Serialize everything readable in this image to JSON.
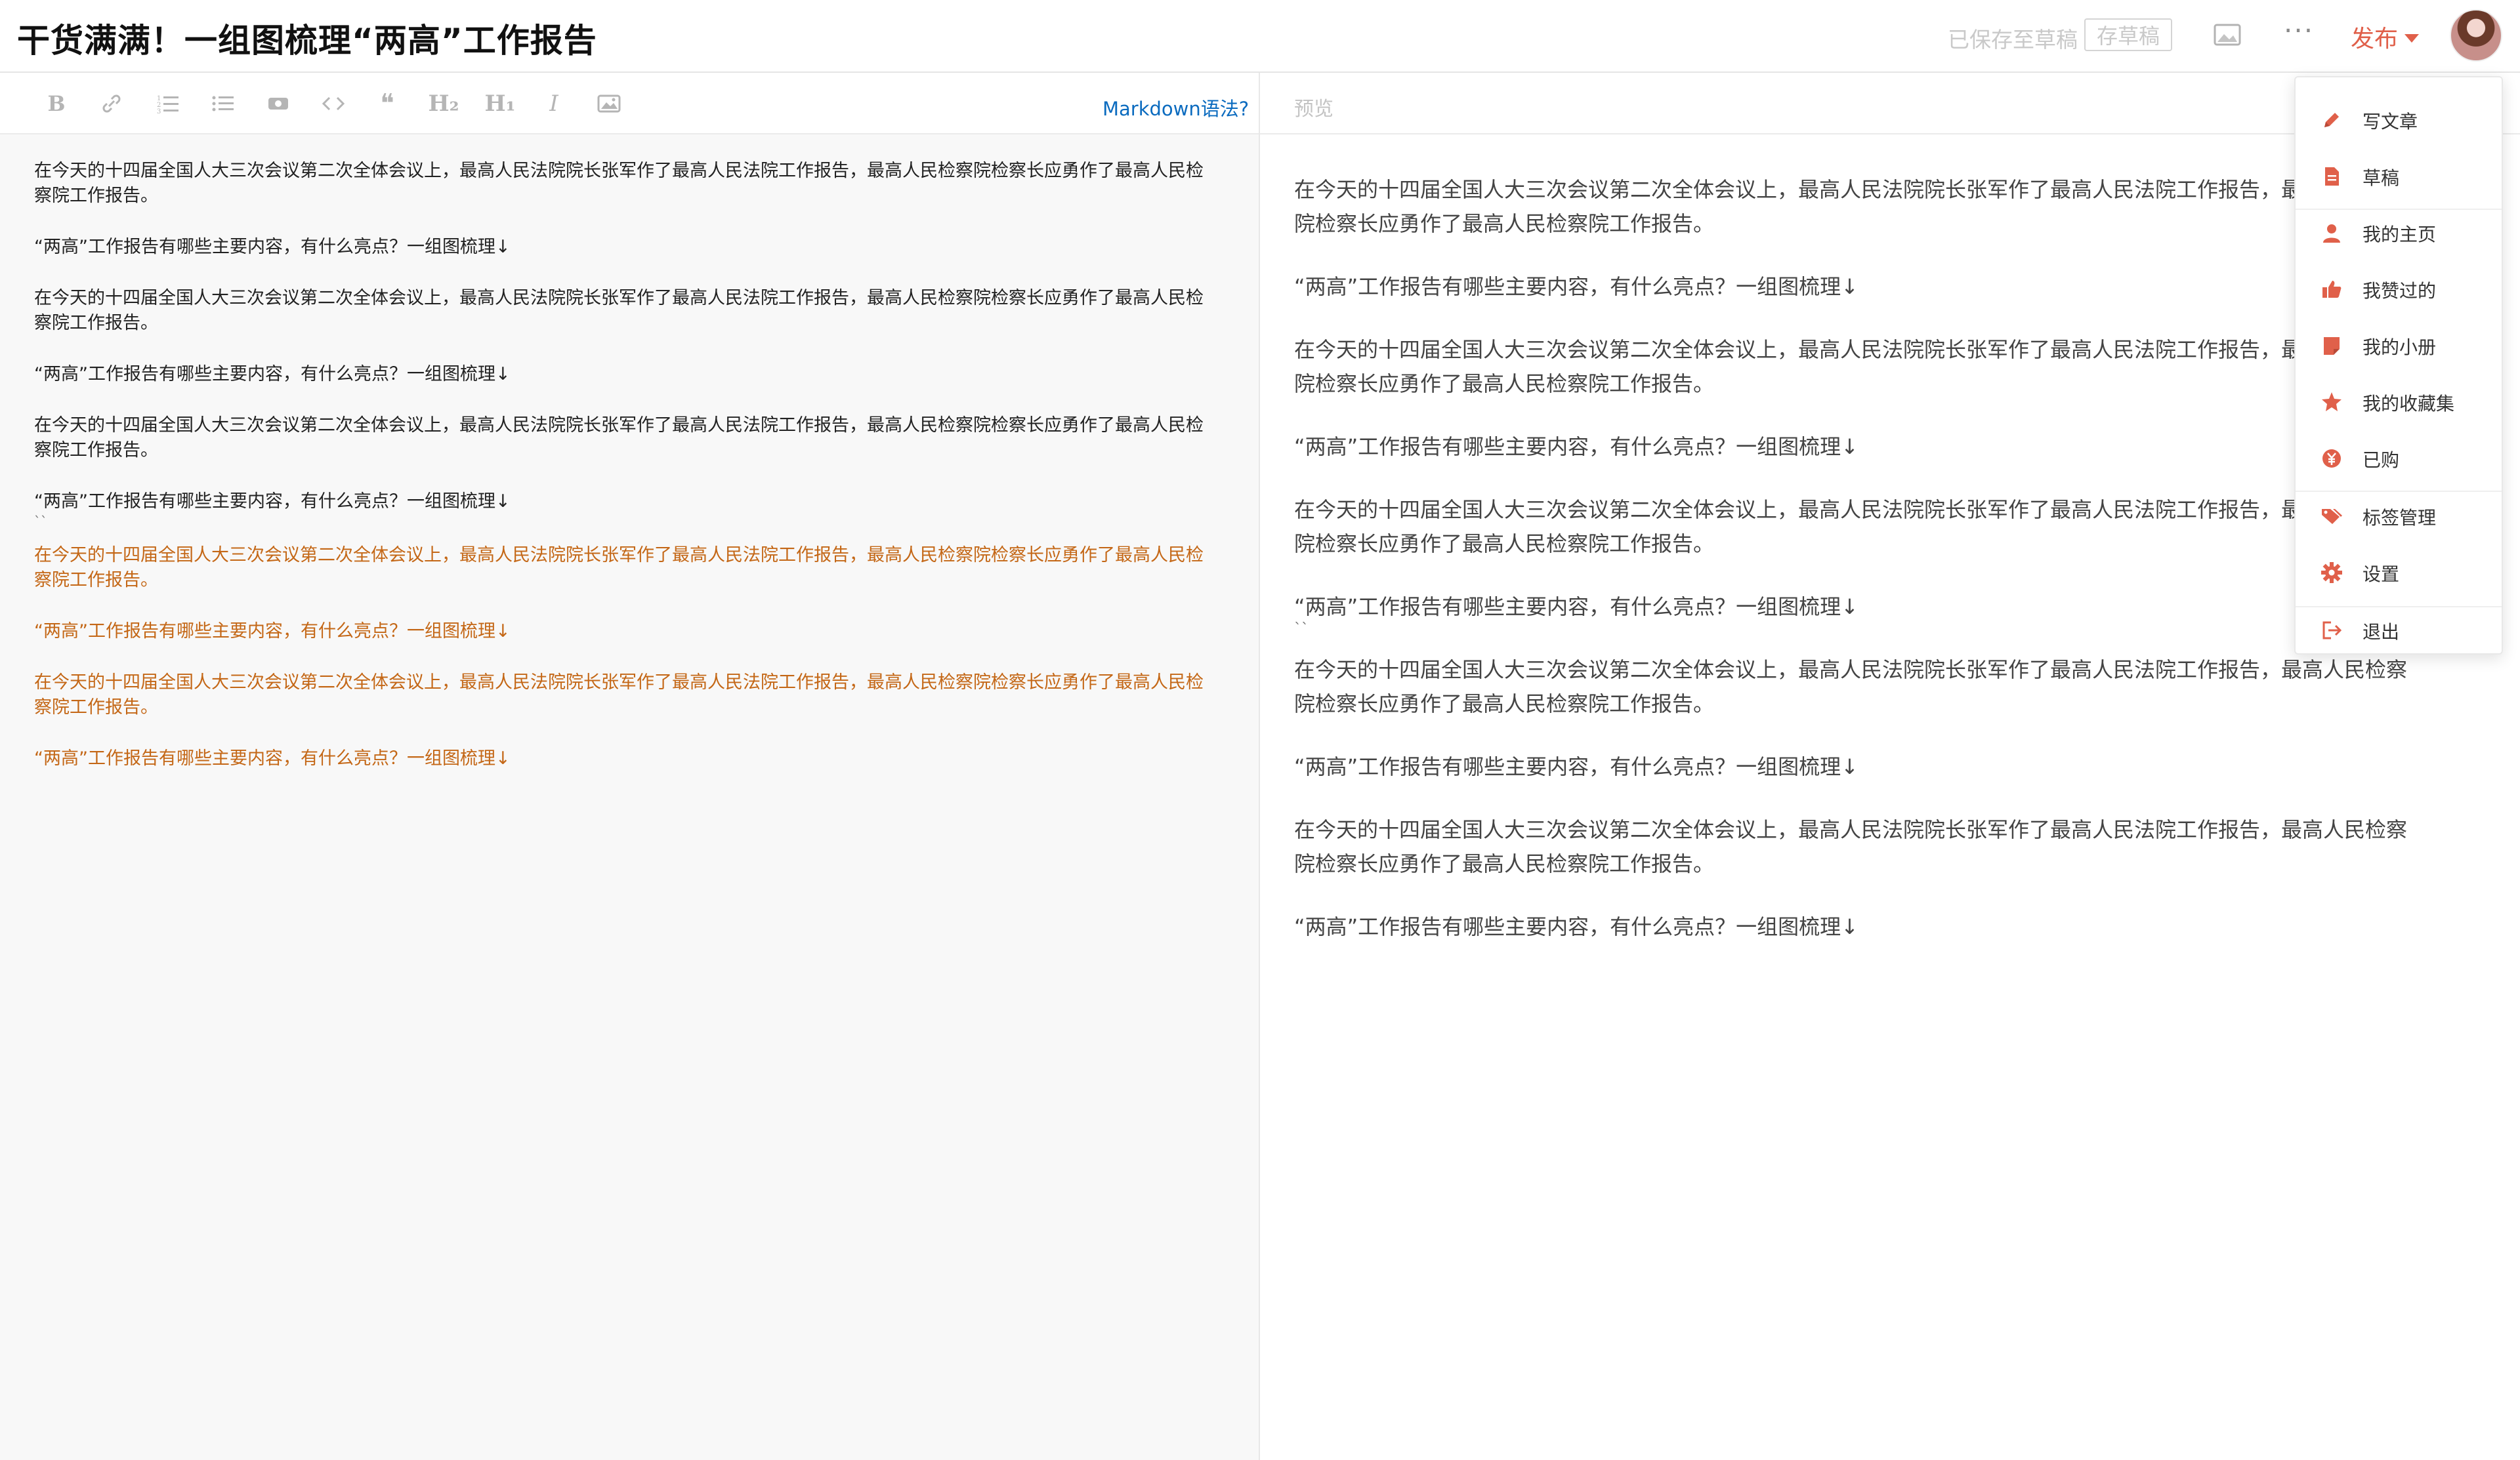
{
  "header": {
    "title": "干货满满！一组图梳理“两高”工作报告",
    "saved_status": "已保存至草稿",
    "save_draft_label": "存草稿",
    "more_label": "···",
    "publish_label": "发布"
  },
  "editor": {
    "markdown_help": "Markdown语法?",
    "toolbar_icons": [
      "bold-icon",
      "link-icon",
      "ordered-list-icon",
      "unordered-list-icon",
      "preview-eye-icon",
      "code-icon",
      "quote-icon",
      "heading-2-icon",
      "heading-1-icon",
      "italic-icon",
      "image-icon"
    ],
    "tb_labels": {
      "bold": "B",
      "h2": "H₂",
      "h1": "H₁",
      "italic": "I",
      "quote": "❝"
    },
    "paragraphs": [
      "在今天的十四届全国人大三次会议第二次全体会议上，最高人民法院院长张军作了最高人民法院工作报告，最高人民检察院检察长应勇作了最高人民检察院工作报告。",
      "“两高”工作报告有哪些主要内容，有什么亮点？一组图梳理↓",
      "在今天的十四届全国人大三次会议第二次全体会议上，最高人民法院院长张军作了最高人民法院工作报告，最高人民检察院检察长应勇作了最高人民检察院工作报告。",
      "“两高”工作报告有哪些主要内容，有什么亮点？一组图梳理↓",
      "在今天的十四届全国人大三次会议第二次全体会议上，最高人民法院院长张军作了最高人民法院工作报告，最高人民检察院检察长应勇作了最高人民检察院工作报告。",
      "“两高”工作报告有哪些主要内容，有什么亮点？一组图梳理↓",
      "``",
      "在今天的十四届全国人大三次会议第二次全体会议上，最高人民法院院长张军作了最高人民法院工作报告，最高人民检察院检察长应勇作了最高人民检察院工作报告。",
      "“两高”工作报告有哪些主要内容，有什么亮点？一组图梳理↓",
      "在今天的十四届全国人大三次会议第二次全体会议上，最高人民法院院长张军作了最高人民法院工作报告，最高人民检察院检察长应勇作了最高人民检察院工作报告。",
      "“两高”工作报告有哪些主要内容，有什么亮点？一组图梳理↓"
    ]
  },
  "preview": {
    "label": "预览",
    "paragraphs": [
      "在今天的十四届全国人大三次会议第二次全体会议上，最高人民法院院长张军作了最高人民法院工作报告，最高人民检察院检察长应勇作了最高人民检察院工作报告。",
      "“两高”工作报告有哪些主要内容，有什么亮点？一组图梳理↓",
      "在今天的十四届全国人大三次会议第二次全体会议上，最高人民法院院长张军作了最高人民法院工作报告，最高人民检察院检察长应勇作了最高人民检察院工作报告。",
      "“两高”工作报告有哪些主要内容，有什么亮点？一组图梳理↓",
      "在今天的十四届全国人大三次会议第二次全体会议上，最高人民法院院长张军作了最高人民法院工作报告，最高人民检察院检察长应勇作了最高人民检察院工作报告。",
      "“两高”工作报告有哪些主要内容，有什么亮点？一组图梳理↓",
      "``",
      "在今天的十四届全国人大三次会议第二次全体会议上，最高人民法院院长张军作了最高人民法院工作报告，最高人民检察院检察长应勇作了最高人民检察院工作报告。",
      "“两高”工作报告有哪些主要内容，有什么亮点？一组图梳理↓",
      "在今天的十四届全国人大三次会议第二次全体会议上，最高人民法院院长张军作了最高人民法院工作报告，最高人民检察院检察长应勇作了最高人民检察院工作报告。",
      "“两高”工作报告有哪些主要内容，有什么亮点？一组图梳理↓"
    ]
  },
  "menu": {
    "items": [
      {
        "label": "写文章",
        "icon": "pencil-icon"
      },
      {
        "label": "草稿",
        "icon": "draft-document-icon"
      },
      {
        "label": "我的主页",
        "icon": "user-icon"
      },
      {
        "label": "我赞过的",
        "icon": "thumbs-up-icon"
      },
      {
        "label": "我的小册",
        "icon": "booklet-icon"
      },
      {
        "label": "我的收藏集",
        "icon": "star-icon"
      },
      {
        "label": "已购",
        "icon": "yuan-coin-icon"
      },
      {
        "label": "标签管理",
        "icon": "tag-icon"
      },
      {
        "label": "设置",
        "icon": "gear-icon"
      },
      {
        "label": "退出",
        "icon": "logout-icon"
      }
    ]
  },
  "colors": {
    "accent": "#e0604a",
    "link": "#0b6bbf",
    "highlight_text": "#c46716",
    "muted": "#c9c9c9"
  }
}
